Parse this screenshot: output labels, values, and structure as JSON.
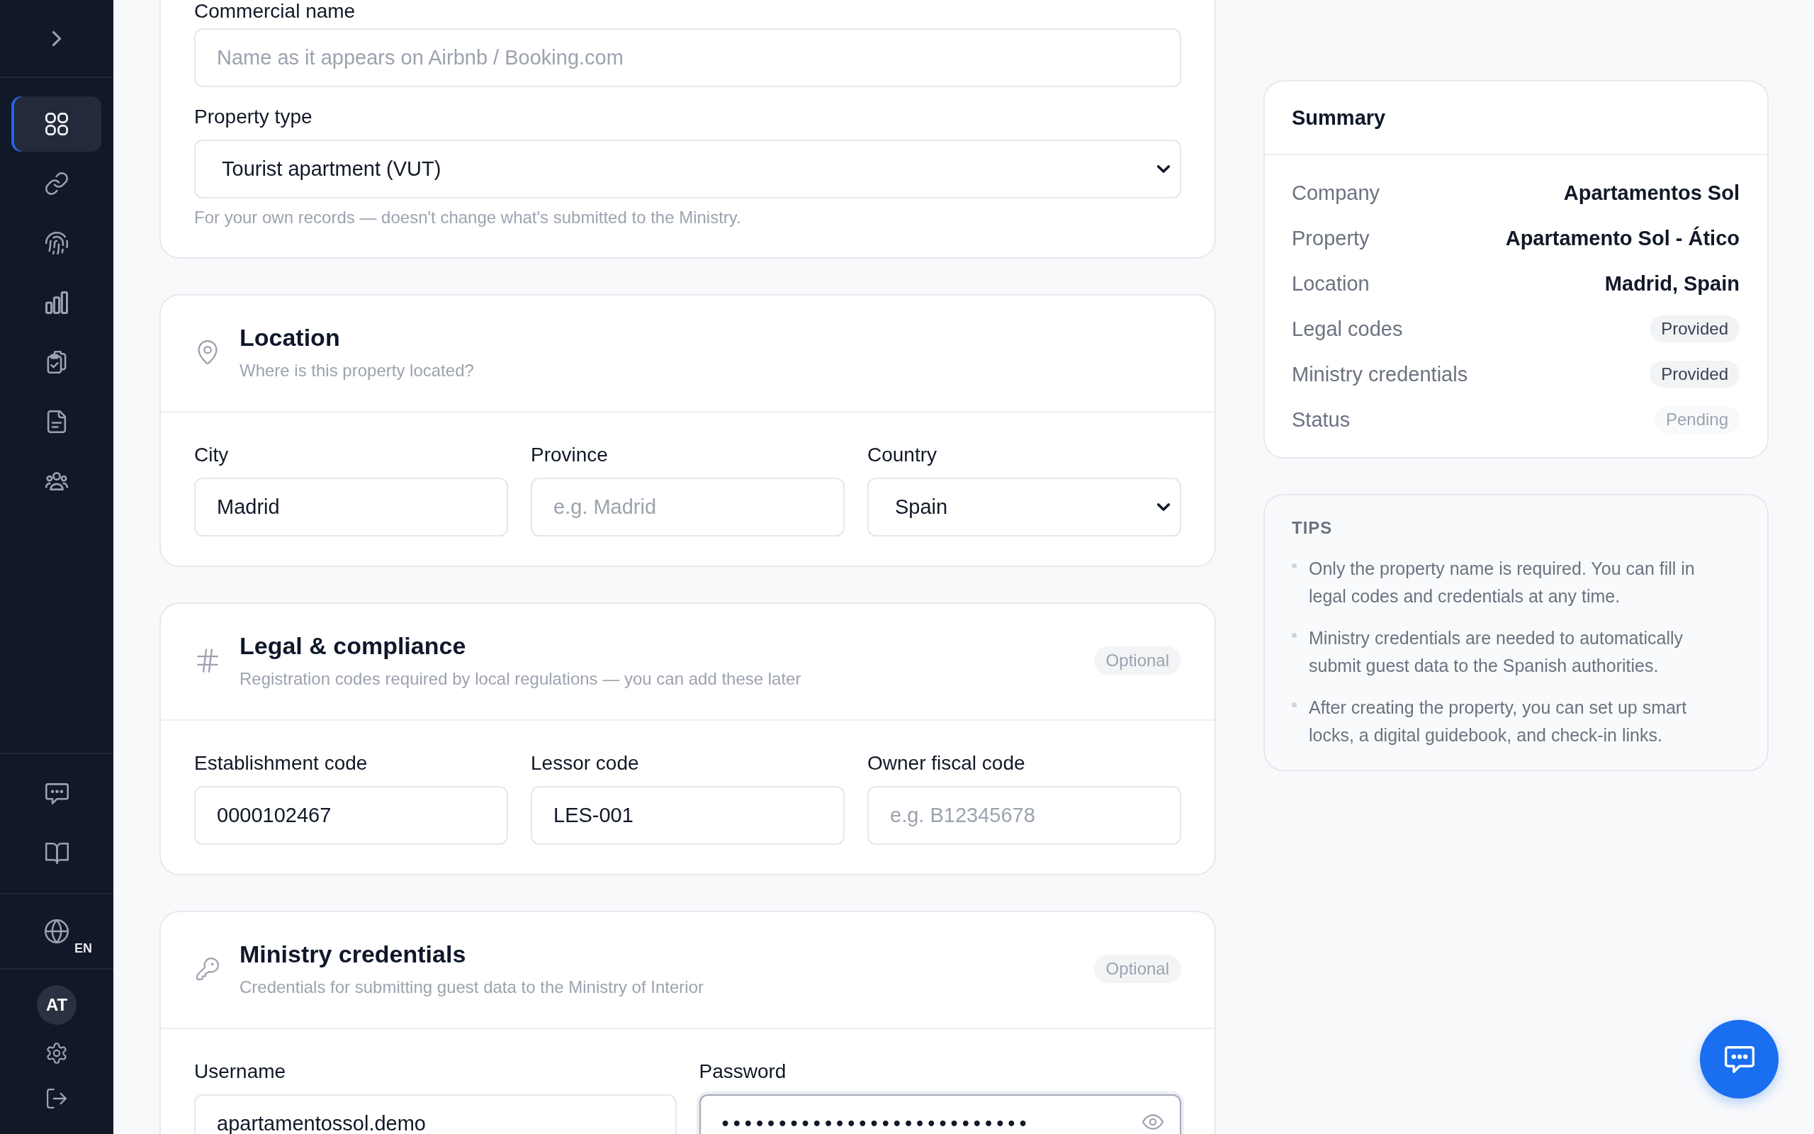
{
  "sidebar": {
    "nav_items": [
      {
        "selected": true
      },
      {
        "selected": false
      },
      {
        "selected": false
      },
      {
        "selected": false
      },
      {
        "selected": false
      },
      {
        "selected": false
      },
      {
        "selected": false
      }
    ],
    "language": "EN",
    "avatar": "AT"
  },
  "sections": [
    {
      "fields": [
        {
          "kind": "input",
          "label": "Commercial name",
          "placeholder": "Name as it appears on Airbnb / Booking.com",
          "focused": false
        },
        {
          "kind": "select",
          "label": "Property type",
          "value": "Tourist apartment (VUT)",
          "hint": "For your own records — doesn't change what's submitted to the Ministry.",
          "focused": false
        }
      ]
    },
    {
      "title": "Location",
      "subtitle": "Where is this property located?",
      "fields": [
        {
          "kind": "input",
          "label": "City",
          "value": "Madrid",
          "focused": false
        },
        {
          "kind": "input",
          "label": "Province",
          "placeholder": "e.g. Madrid",
          "focused": false
        },
        {
          "kind": "select",
          "label": "Country",
          "value": "Spain",
          "focused": false
        }
      ]
    },
    {
      "title": "Legal & compliance",
      "subtitle": "Registration codes required by local regulations — you can add these later",
      "badge": "Optional",
      "fields": [
        {
          "kind": "input",
          "label": "Establishment code",
          "value": "0000102467",
          "focused": false
        },
        {
          "kind": "input",
          "label": "Lessor code",
          "value": "LES-001",
          "focused": false
        },
        {
          "kind": "input",
          "label": "Owner fiscal code",
          "placeholder": "e.g. B12345678",
          "focused": false
        }
      ]
    },
    {
      "title": "Ministry credentials",
      "subtitle": "Credentials for submitting guest data to the Ministry of Interior",
      "badge": "Optional",
      "fields": [
        {
          "kind": "input",
          "label": "Username",
          "value": "apartamentossol.demo",
          "focused": false
        },
        {
          "kind": "password",
          "label": "Password",
          "value": "•••••••••••••••••••••••••••",
          "focused": true
        }
      ]
    }
  ],
  "summary": {
    "title": "Summary",
    "rows": [
      {
        "kind": "text",
        "label": "Company",
        "value": "Apartamentos Sol",
        "muted": false
      },
      {
        "kind": "text",
        "label": "Property",
        "value": "Apartamento Sol - Ático",
        "muted": false
      },
      {
        "kind": "text",
        "label": "Location",
        "value": "Madrid, Spain",
        "muted": false
      },
      {
        "kind": "badge",
        "label": "Legal codes",
        "value": "Provided",
        "muted": false
      },
      {
        "kind": "badge",
        "label": "Ministry credentials",
        "value": "Provided",
        "muted": false
      },
      {
        "kind": "badge",
        "label": "Status",
        "value": "Pending",
        "muted": true
      }
    ]
  },
  "tips": {
    "title": "TIPS",
    "items": [
      "Only the property name is required. You can fill in legal codes and credentials at any time.",
      "Ministry credentials are needed to automatically submit guest data to the Spanish authorities.",
      "After creating the property, you can set up smart locks, a digital guidebook, and check-in links."
    ]
  }
}
